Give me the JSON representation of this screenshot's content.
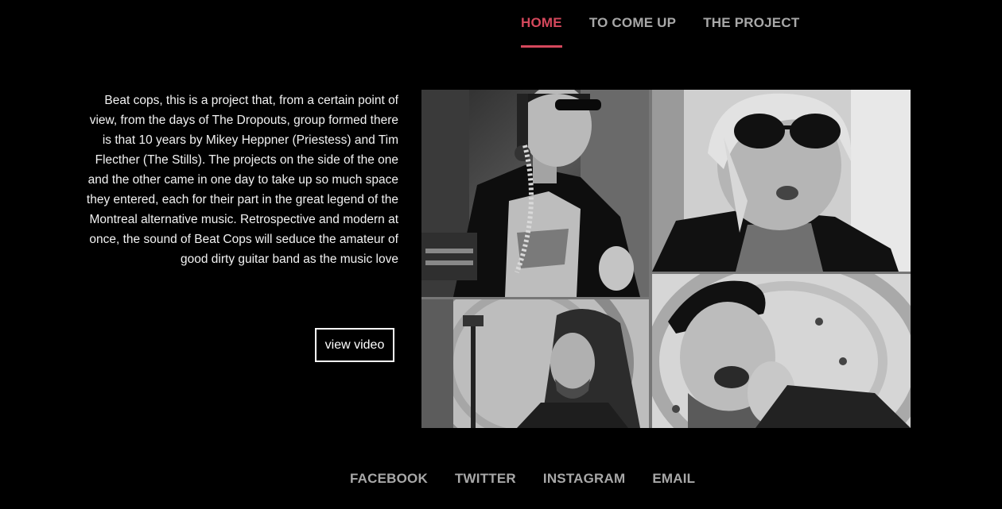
{
  "nav": {
    "items": [
      {
        "label": "HOME",
        "active": true
      },
      {
        "label": "TO COME UP",
        "active": false
      },
      {
        "label": "THE PROJECT",
        "active": false
      }
    ],
    "active_color": "#d5485c",
    "inactive_color": "#a8a8a8"
  },
  "intro": {
    "text": "Beat cops, this is a project that, from a certain point of view, from the days of The Dropouts, group formed there is that 10 years by Mikey Heppner (Priestess) and Tim Flecther (The Stills). The projects on the side of the one and the other came in one day to take up so much space they entered, each for their part in the great legend of the Montreal alternative music. Retrospective and modern at once, the sound of Beat Cops will seduce the amateur of good dirty guitar band as the music love",
    "button_label": "view video"
  },
  "collage": {
    "style": "black-and-white",
    "photos": [
      {
        "name": "band-member-telephone"
      },
      {
        "name": "band-member-sunglasses"
      },
      {
        "name": "band-member-long-hair"
      },
      {
        "name": "band-member-cap"
      }
    ]
  },
  "footer": {
    "links": [
      "FACEBOOK",
      "TWITTER",
      "INSTAGRAM",
      "EMAIL"
    ]
  }
}
